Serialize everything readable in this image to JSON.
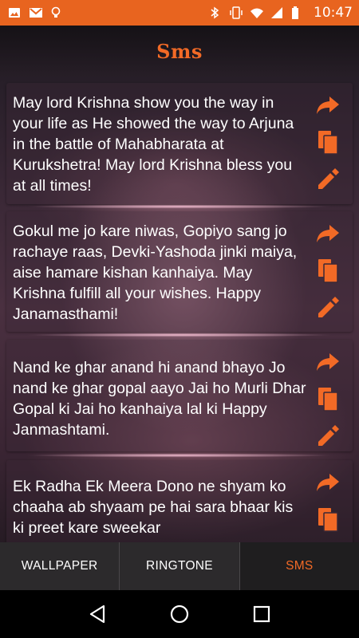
{
  "status_bar": {
    "time": "10:47",
    "left_icons": [
      "image-icon",
      "gmail-icon",
      "lightbulb-icon"
    ],
    "right_icons": [
      "bluetooth-icon",
      "vibrate-icon",
      "wifi-icon",
      "signal-icon",
      "battery-icon"
    ]
  },
  "header": {
    "title": "Sms"
  },
  "messages": [
    {
      "text": "May lord Krishna show you the way in your life  as He showed the way to Arjuna in the battle of  Mahabharata at Kurukshetra! May lord Krishna bless you at all times!"
    },
    {
      "text": "Gokul me jo kare niwas, Gopiyo sang jo rachaye raas, Devki-Yashoda jinki maiya, aise hamare kishan kanhaiya. May Krishna fulfill all your wishes. Happy Janamasthami!"
    },
    {
      "text": "Nand ke ghar anand hi anand bhayo Jo nand ke ghar gopal aayo Jai ho Murli Dhar Gopal ki Jai ho kanhaiya lal ki Happy Janmashtami."
    },
    {
      "text": "Ek Radha Ek Meera Dono ne shyam ko chaaha ab shyaam pe hai sara bhaar kis ki preet kare sweekar"
    }
  ],
  "actions": [
    "share-icon",
    "copy-icon",
    "edit-icon"
  ],
  "tabs": [
    {
      "label": "WALLPAPER",
      "active": false
    },
    {
      "label": "RINGTONE",
      "active": false
    },
    {
      "label": "SMS",
      "active": true
    }
  ],
  "colors": {
    "accent": "#f26a26",
    "status_bar": "#e8641f",
    "tab_bar": "#2c2a2c"
  }
}
